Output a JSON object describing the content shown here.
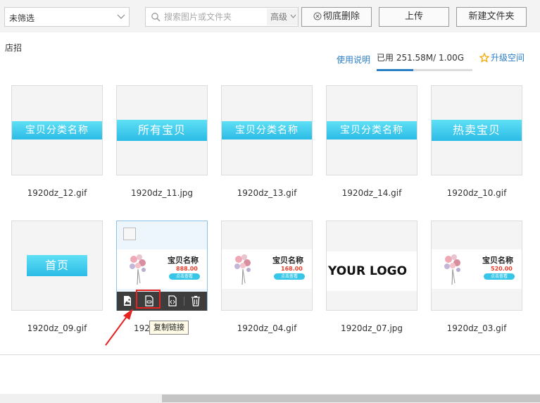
{
  "toolbar": {
    "filter": {
      "selected": "未筛选"
    },
    "search": {
      "placeholder": "搜索图片或文件夹",
      "advanced_label": "高级"
    },
    "delete_label": "彻底删除",
    "upload_label": "上传",
    "new_folder_label": "新建文件夹"
  },
  "folder": {
    "name": "店招"
  },
  "storage": {
    "help_label": "使用说明",
    "used_text": "已用 251.58M/ 1.00G",
    "used_fraction": 0.2457,
    "upgrade_label": "升级空间"
  },
  "files": [
    {
      "name": "1920dz_12.gif",
      "banner": "宝贝分类名称"
    },
    {
      "name": "1920dz_11.jpg",
      "banner": "所有宝贝"
    },
    {
      "name": "1920dz_13.gif",
      "banner": "宝贝分类名称"
    },
    {
      "name": "1920dz_14.gif",
      "banner": "宝贝分类名称"
    },
    {
      "name": "1920dz_10.gif",
      "banner": "热卖宝贝"
    },
    {
      "name": "1920dz_09.gif",
      "banner": "首页"
    },
    {
      "name": "192",
      "title": "宝贝名称",
      "price": "888.00",
      "button": "点击查看"
    },
    {
      "name": "1920dz_04.gif",
      "title": "宝贝名称",
      "price": "168.00",
      "button": "点击查看"
    },
    {
      "name": "1920dz_07.jpg",
      "logo": "YOUR LOGO"
    },
    {
      "name": "1920dz_03.gif",
      "title": "宝贝名称",
      "price": "520.00",
      "button": "点击查看"
    }
  ],
  "tooltip": "复制链接",
  "colors": {
    "accent": "#2b7fc7",
    "highlight": "#e52421",
    "banner": "#3cc8ef",
    "price": "#e8402e"
  },
  "icons": [
    "chevron-down-icon",
    "search-icon",
    "trash-icon",
    "star-icon",
    "image-edit-icon",
    "copy-link-icon",
    "code-icon",
    "arrow-pointer-icon"
  ]
}
